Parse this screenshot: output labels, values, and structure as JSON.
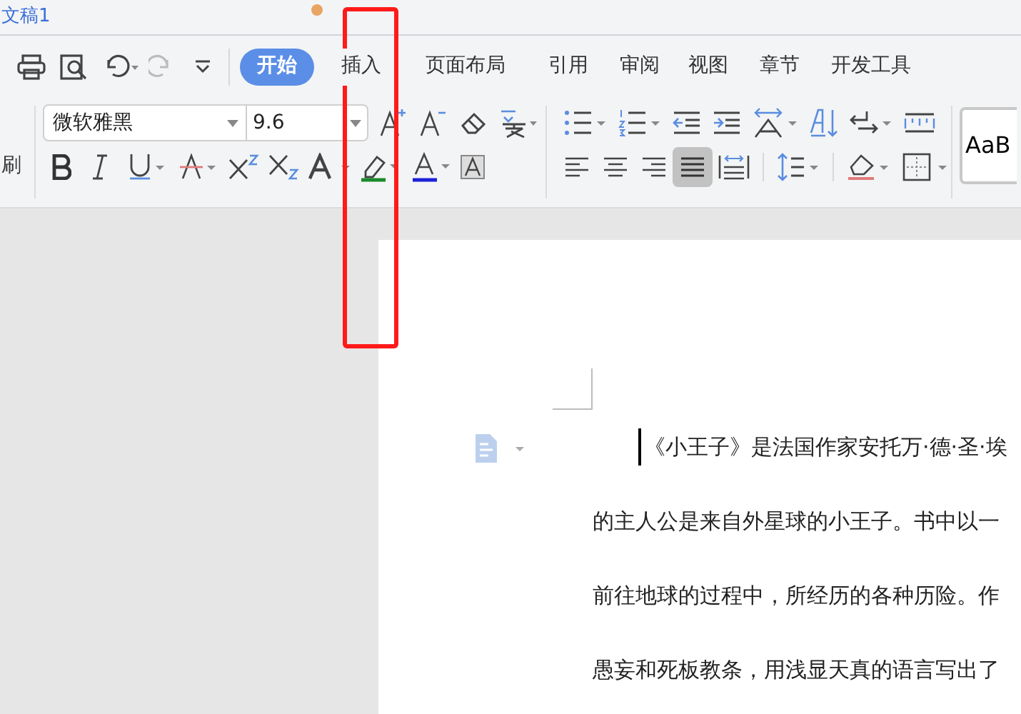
{
  "window": {
    "title": "文稿1",
    "unsaved": true
  },
  "tabs": [
    {
      "label": "开始",
      "selected": true
    },
    {
      "label": "插入",
      "selected": false
    },
    {
      "label": "页面布局",
      "selected": false
    },
    {
      "label": "引用",
      "selected": false
    },
    {
      "label": "审阅",
      "selected": false
    },
    {
      "label": "视图",
      "selected": false
    },
    {
      "label": "章节",
      "selected": false
    },
    {
      "label": "开发工具",
      "selected": false
    }
  ],
  "toolbar": {
    "left_label": "刷",
    "font_name": "微软雅黑",
    "font_size": "9.6",
    "style_preview": "AaB"
  },
  "document": {
    "paragraph_lines": [
      "《小王子》是法国作家安托万·德·圣·埃",
      "的主人公是来自外星球的小王子。书中以一",
      "前往地球的过程中，所经历的各种历险。作",
      "愚妄和死板教条，用浅显天真的语言写出了"
    ]
  }
}
